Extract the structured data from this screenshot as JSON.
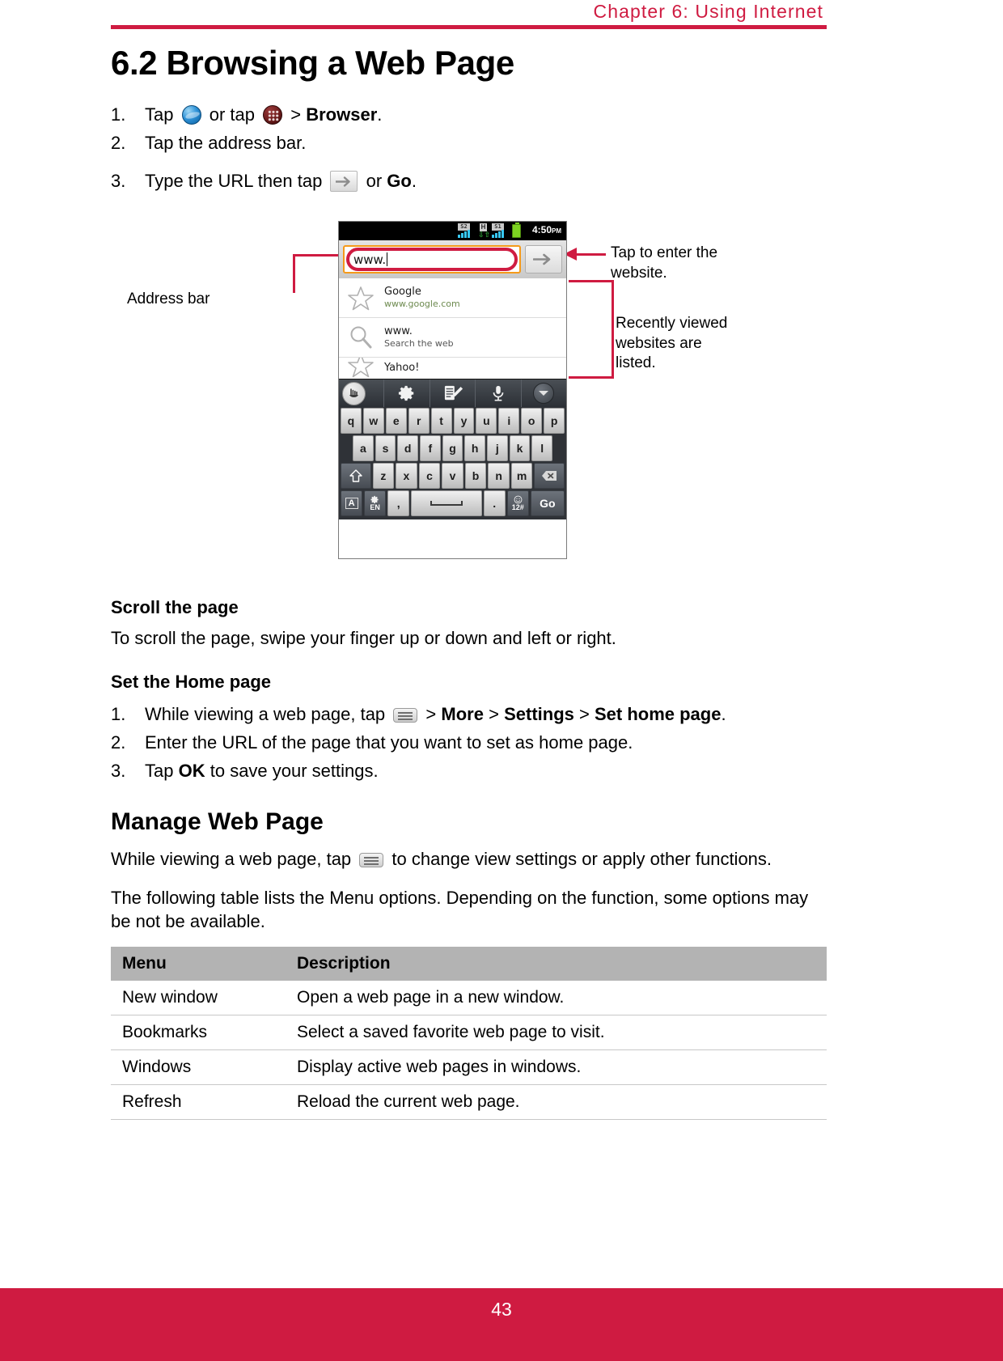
{
  "header": {
    "chapter": "Chapter 6: Using Internet",
    "rule_color": "#cf1b41"
  },
  "section": {
    "title": "6.2 Browsing a Web Page"
  },
  "steps_browse": [
    {
      "num": "1.",
      "before": "Tap",
      "icon1": "globe-icon",
      "mid": "or tap",
      "icon2": "app-drawer-icon",
      "sep": ">",
      "bold": "Browser",
      "after": "."
    },
    {
      "num": "2.",
      "text": "Tap the address bar."
    },
    {
      "num": "3.",
      "before": "Type the URL then tap",
      "icon": "go-arrow-icon",
      "mid": "or",
      "bold": "Go",
      "after": "."
    }
  ],
  "figure": {
    "phone": {
      "statusbar": {
        "signal1_label": "S2",
        "data_label": "H",
        "signal2_label": "S1",
        "battery": "battery-icon",
        "time": "4:50",
        "ampm": "PM"
      },
      "address_bar": {
        "value": "www.",
        "go_icon": "arrow-right-icon"
      },
      "suggestions": [
        {
          "icon": "star-icon",
          "title": "Google",
          "subtitle": "www.google.com",
          "sub_style": "green"
        },
        {
          "icon": "search-icon",
          "title": "www.",
          "subtitle": "Search the web",
          "sub_style": "grey"
        },
        {
          "icon": "star-icon",
          "title": "Yahoo!",
          "subtitle": "",
          "sub_style": "grey"
        }
      ],
      "ime_toolbar": [
        {
          "icon": "touch-hand-icon"
        },
        {
          "icon": "gear-icon"
        },
        {
          "icon": "edit-note-icon"
        },
        {
          "icon": "microphone-icon"
        },
        {
          "icon": "chevron-down-icon"
        }
      ],
      "keyboard": {
        "row1": [
          "q",
          "w",
          "e",
          "r",
          "t",
          "y",
          "u",
          "i",
          "o",
          "p"
        ],
        "row2": [
          "a",
          "s",
          "d",
          "f",
          "g",
          "h",
          "j",
          "k",
          "l"
        ],
        "row3_shift": "shift-icon",
        "row3": [
          "z",
          "x",
          "c",
          "v",
          "b",
          "n",
          "m"
        ],
        "row3_back": "backspace-icon",
        "row4": [
          {
            "label": "A",
            "name": "symbols-key"
          },
          {
            "label": "EN",
            "name": "language-key",
            "icon": "gear-icon"
          },
          {
            "label": ",",
            "name": "comma-key"
          },
          {
            "label": "",
            "name": "space-key"
          },
          {
            "label": ".",
            "name": "period-key"
          },
          {
            "label": "12#",
            "name": "numbers-key",
            "icon": "smiley-icon"
          },
          {
            "label": "Go",
            "name": "go-key"
          }
        ]
      }
    },
    "callouts": {
      "address_bar": "Address bar",
      "tap_enter": "Tap to enter the\nwebsite.",
      "tap_enter_line1": "Tap to enter the",
      "tap_enter_line2": "website.",
      "recent_line1": "Recently viewed",
      "recent_line2": "websites are",
      "recent_line3": "listed."
    }
  },
  "scroll_section": {
    "heading": "Scroll the page",
    "body": "To scroll the page, swipe your finger up or down and left or right."
  },
  "home_section": {
    "heading": "Set the Home page",
    "steps": [
      {
        "num": "1.",
        "before": "While viewing a web page, tap",
        "icon": "menu-key-icon",
        "sep1": ">",
        "b1": "More",
        "sep2": ">",
        "b2": "Settings",
        "sep3": ">",
        "b3": "Set home page",
        "after": "."
      },
      {
        "num": "2.",
        "text": "Enter the URL of the page that you want to set as home page."
      },
      {
        "num": "3.",
        "before": "Tap",
        "bold": "OK",
        "after": "to save your settings."
      }
    ]
  },
  "manage_section": {
    "heading": "Manage Web Page",
    "para1_before": "While viewing a web page, tap",
    "para1_icon": "menu-key-icon",
    "para1_after": "to change view settings or apply other functions.",
    "para2": "The following table lists the Menu options. Depending on the function, some options may be not be available."
  },
  "menu_table": {
    "columns": [
      "Menu",
      "Description"
    ],
    "rows": [
      [
        "New window",
        "Open a web page in a new window."
      ],
      [
        "Bookmarks",
        "Select a saved favorite web page to visit."
      ],
      [
        "Windows",
        "Display active web pages in windows."
      ],
      [
        "Refresh",
        "Reload the current web page."
      ]
    ]
  },
  "footer": {
    "page_number": "43",
    "bar_color": "#cf1b41"
  }
}
